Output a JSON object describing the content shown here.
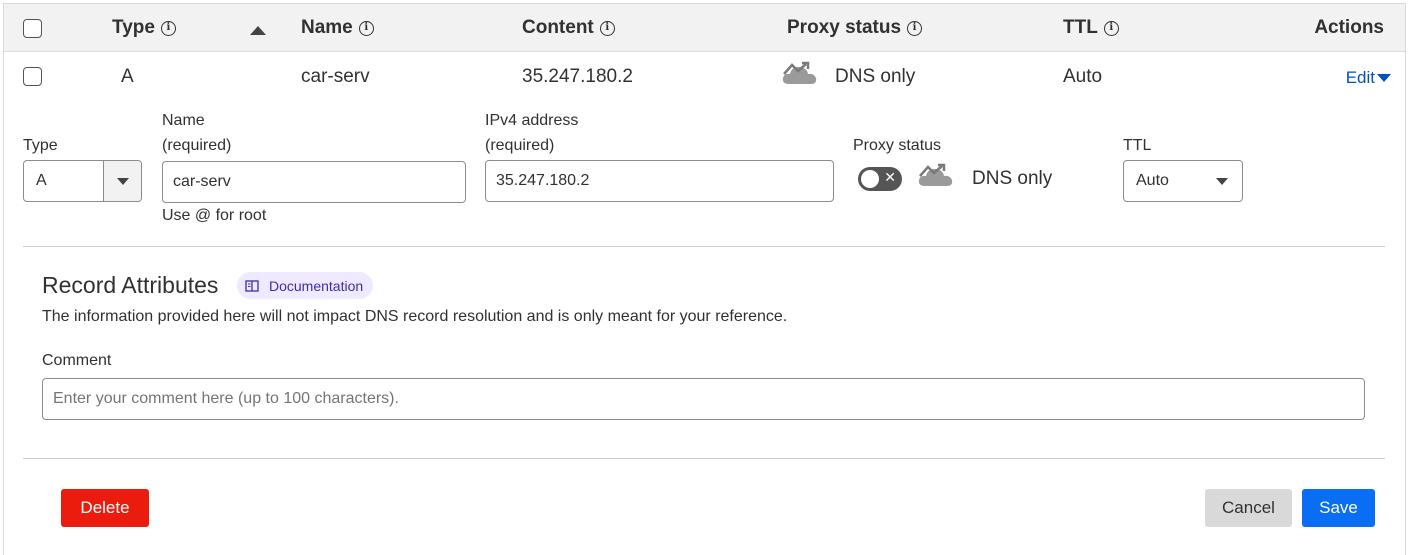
{
  "table_header": {
    "type": "Type",
    "name": "Name",
    "content": "Content",
    "proxy_status": "Proxy status",
    "ttl": "TTL",
    "actions": "Actions"
  },
  "record_row": {
    "type": "A",
    "name": "car-serv",
    "content": "35.247.180.2",
    "proxy_status": "DNS only",
    "ttl": "Auto",
    "edit_label": "Edit"
  },
  "edit_form": {
    "type_label": "Type",
    "type_value": "A",
    "name_label_line1": "Name",
    "name_label_line2": "(required)",
    "name_value": "car-serv",
    "name_hint": "Use @ for root",
    "ipv4_label_line1": "IPv4 address",
    "ipv4_label_line2": "(required)",
    "ipv4_value": "35.247.180.2",
    "proxy_label": "Proxy status",
    "proxy_value": "DNS only",
    "ttl_label": "TTL",
    "ttl_value": "Auto"
  },
  "record_attributes": {
    "title": "Record Attributes",
    "doc_badge": "Documentation",
    "description": "The information provided here will not impact DNS record resolution and is only meant for your reference.",
    "comment_label": "Comment",
    "comment_placeholder": "Enter your comment here (up to 100 characters)."
  },
  "buttons": {
    "delete": "Delete",
    "cancel": "Cancel",
    "save": "Save"
  },
  "colors": {
    "delete_bg": "#eb1b0e",
    "save_bg": "#0a6ef5",
    "cancel_bg": "#d9d9d9",
    "link": "#0051c3",
    "doc_badge_bg": "#efeaff"
  },
  "icons": {
    "info": "info-circle-icon",
    "sort": "sort-ascending-icon",
    "proxy": "cloud-dns-only-icon",
    "doc": "book-icon"
  }
}
